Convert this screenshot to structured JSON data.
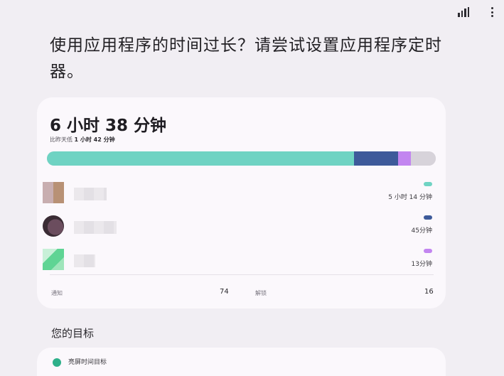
{
  "topbar": {
    "stats_icon": "bar-chart-icon",
    "more_icon": "more-vertical-icon"
  },
  "headline": "使用应用程序的时间过长？请尝试设置应用程序定时器。",
  "summary": {
    "total": "6 小时 38 分钟",
    "compare_prefix": "比昨天低",
    "compare_value": "1 小时 42 分钟"
  },
  "usage_bar": {
    "segments": [
      {
        "fraction": 0.79,
        "color": "#6fd3c3"
      },
      {
        "fraction": 0.113,
        "color": "#3d5a9a"
      },
      {
        "fraction": 0.033,
        "color": "#c285f0"
      },
      {
        "fraction": 0.064,
        "color": "#d7d3da"
      }
    ]
  },
  "apps": [
    {
      "time": "5 小时 14 分钟",
      "color": "#6fd3c3"
    },
    {
      "time": "45分钟",
      "color": "#3d5a9a"
    },
    {
      "time": "13分钟",
      "color": "#c285f0"
    }
  ],
  "stats": {
    "notifications_label": "通知",
    "notifications_value": "74",
    "unlocks_label": "解锁",
    "unlocks_value": "16"
  },
  "goals": {
    "title": "您的目标",
    "first_item_label": "亮屏时间目标"
  },
  "colors": {
    "background": "#f1eef3",
    "card": "#fbf8fc",
    "accent_teal": "#6fd3c3",
    "accent_blue": "#3d5a9a",
    "accent_purple": "#c285f0",
    "goal_green": "#2eb08a"
  }
}
